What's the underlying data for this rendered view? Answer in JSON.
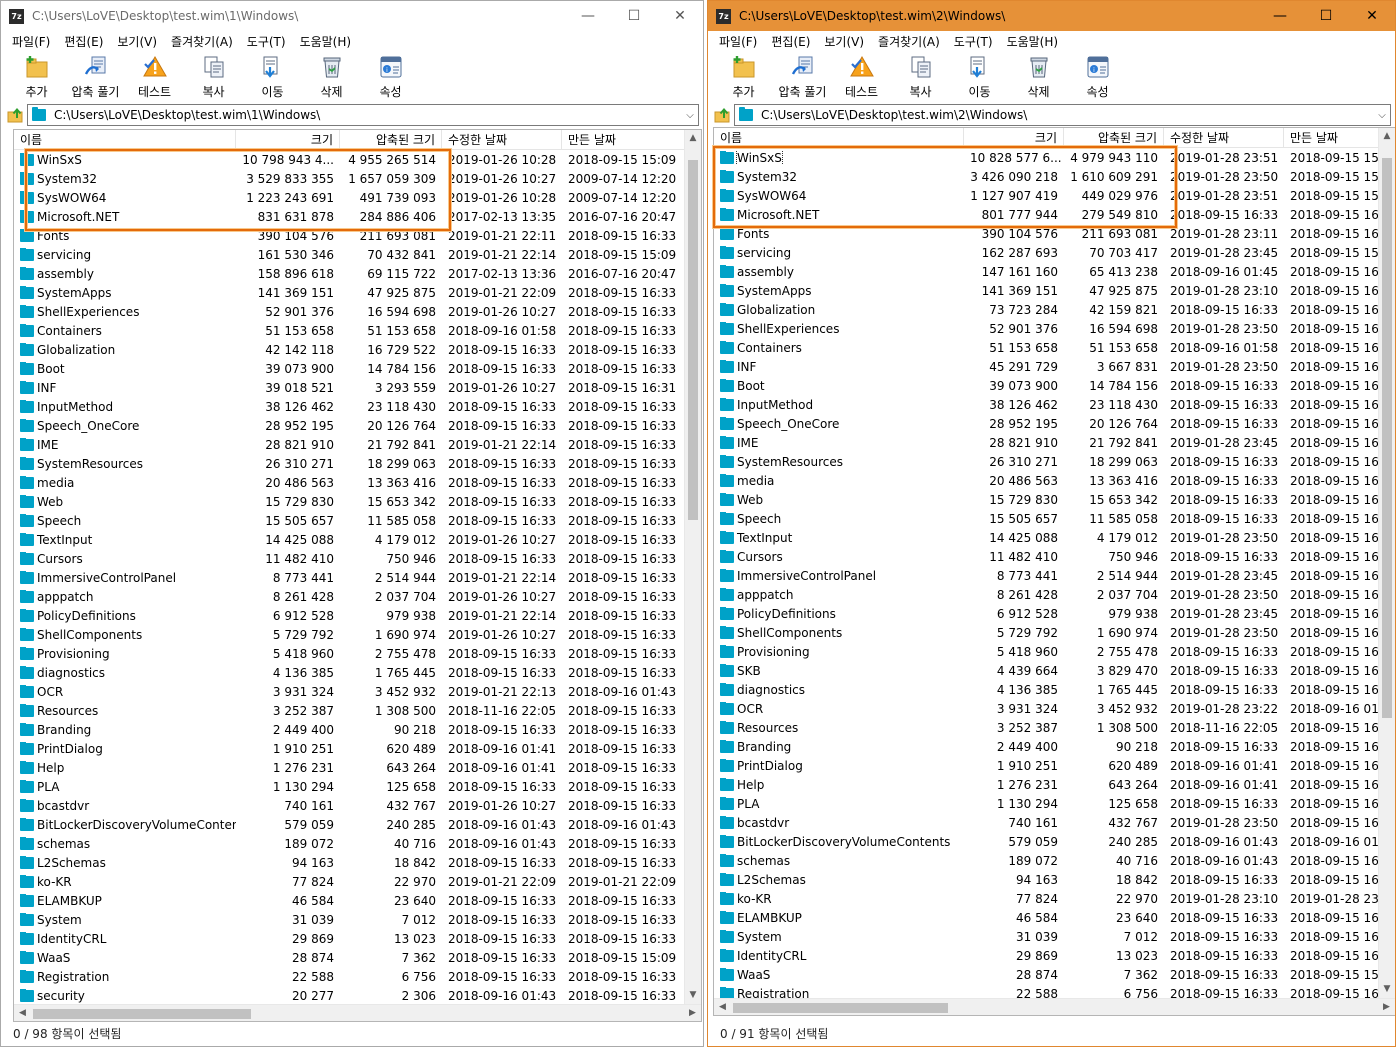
{
  "windows": [
    {
      "title": "C:\\Users\\LoVE\\Desktop\\test.wim\\1\\Windows\\",
      "path": "C:\\Users\\LoVE\\Desktop\\test.wim\\1\\Windows\\",
      "status": "0 / 98 항목이 선택됨",
      "accent": "#ffffff",
      "rows": [
        [
          "WinSxS",
          "10 798 943 4...",
          "4 955 265 514",
          "2019-01-26 10:28",
          "2018-09-15 15:09"
        ],
        [
          "System32",
          "3 529 833 355",
          "1 657 059 309",
          "2019-01-26 10:27",
          "2009-07-14 12:20"
        ],
        [
          "SysWOW64",
          "1 223 243 691",
          "491 739 093",
          "2019-01-26 10:28",
          "2009-07-14 12:20"
        ],
        [
          "Microsoft.NET",
          "831 631 878",
          "284 886 406",
          "2017-02-13 13:35",
          "2016-07-16 20:47"
        ],
        [
          "Fonts",
          "390 104 576",
          "211 693 081",
          "2019-01-21 22:11",
          "2018-09-15 16:33"
        ],
        [
          "servicing",
          "161 530 346",
          "70 432 841",
          "2019-01-21 22:14",
          "2018-09-15 15:09"
        ],
        [
          "assembly",
          "158 896 618",
          "69 115 722",
          "2017-02-13 13:36",
          "2016-07-16 20:47"
        ],
        [
          "SystemApps",
          "141 369 151",
          "47 925 875",
          "2019-01-21 22:09",
          "2018-09-15 16:33"
        ],
        [
          "ShellExperiences",
          "52 901 376",
          "16 594 698",
          "2019-01-26 10:27",
          "2018-09-15 16:33"
        ],
        [
          "Containers",
          "51 153 658",
          "51 153 658",
          "2018-09-16 01:58",
          "2018-09-15 16:33"
        ],
        [
          "Globalization",
          "42 142 118",
          "16 729 522",
          "2018-09-15 16:33",
          "2018-09-15 16:33"
        ],
        [
          "Boot",
          "39 073 900",
          "14 784 156",
          "2018-09-15 16:33",
          "2018-09-15 16:33"
        ],
        [
          "INF",
          "39 018 521",
          "3 293 559",
          "2019-01-26 10:27",
          "2018-09-15 16:31"
        ],
        [
          "InputMethod",
          "38 126 462",
          "23 118 430",
          "2018-09-15 16:33",
          "2018-09-15 16:33"
        ],
        [
          "Speech_OneCore",
          "28 952 195",
          "20 126 764",
          "2018-09-15 16:33",
          "2018-09-15 16:33"
        ],
        [
          "IME",
          "28 821 910",
          "21 792 841",
          "2019-01-21 22:14",
          "2018-09-15 16:33"
        ],
        [
          "SystemResources",
          "26 310 271",
          "18 299 063",
          "2018-09-15 16:33",
          "2018-09-15 16:33"
        ],
        [
          "media",
          "20 486 563",
          "13 363 416",
          "2018-09-15 16:33",
          "2018-09-15 16:33"
        ],
        [
          "Web",
          "15 729 830",
          "15 653 342",
          "2018-09-15 16:33",
          "2018-09-15 16:33"
        ],
        [
          "Speech",
          "15 505 657",
          "11 585 058",
          "2018-09-15 16:33",
          "2018-09-15 16:33"
        ],
        [
          "TextInput",
          "14 425 088",
          "4 179 012",
          "2019-01-26 10:27",
          "2018-09-15 16:33"
        ],
        [
          "Cursors",
          "11 482 410",
          "750 946",
          "2018-09-15 16:33",
          "2018-09-15 16:33"
        ],
        [
          "ImmersiveControlPanel",
          "8 773 441",
          "2 514 944",
          "2019-01-21 22:14",
          "2018-09-15 16:33"
        ],
        [
          "apppatch",
          "8 261 428",
          "2 037 704",
          "2019-01-26 10:27",
          "2018-09-15 16:33"
        ],
        [
          "PolicyDefinitions",
          "6 912 528",
          "979 938",
          "2019-01-21 22:14",
          "2018-09-15 16:33"
        ],
        [
          "ShellComponents",
          "5 729 792",
          "1 690 974",
          "2019-01-26 10:27",
          "2018-09-15 16:33"
        ],
        [
          "Provisioning",
          "5 418 960",
          "2 755 478",
          "2018-09-15 16:33",
          "2018-09-15 16:33"
        ],
        [
          "diagnostics",
          "4 136 385",
          "1 765 445",
          "2018-09-15 16:33",
          "2018-09-15 16:33"
        ],
        [
          "OCR",
          "3 931 324",
          "3 452 932",
          "2019-01-21 22:13",
          "2018-09-16 01:43"
        ],
        [
          "Resources",
          "3 252 387",
          "1 308 500",
          "2018-11-16 22:05",
          "2018-09-15 16:33"
        ],
        [
          "Branding",
          "2 449 400",
          "90 218",
          "2018-09-15 16:33",
          "2018-09-15 16:33"
        ],
        [
          "PrintDialog",
          "1 910 251",
          "620 489",
          "2018-09-16 01:41",
          "2018-09-15 16:33"
        ],
        [
          "Help",
          "1 276 231",
          "643 264",
          "2018-09-16 01:41",
          "2018-09-15 16:33"
        ],
        [
          "PLA",
          "1 130 294",
          "125 658",
          "2018-09-15 16:33",
          "2018-09-15 16:33"
        ],
        [
          "bcastdvr",
          "740 161",
          "432 767",
          "2019-01-26 10:27",
          "2018-09-15 16:33"
        ],
        [
          "BitLockerDiscoveryVolumeContents",
          "579 059",
          "240 285",
          "2018-09-16 01:43",
          "2018-09-16 01:43"
        ],
        [
          "schemas",
          "189 072",
          "40 716",
          "2018-09-16 01:43",
          "2018-09-15 16:33"
        ],
        [
          "L2Schemas",
          "94 163",
          "18 842",
          "2018-09-15 16:33",
          "2018-09-15 16:33"
        ],
        [
          "ko-KR",
          "77 824",
          "22 970",
          "2019-01-21 22:09",
          "2019-01-21 22:09"
        ],
        [
          "ELAMBKUP",
          "46 584",
          "23 640",
          "2018-09-15 16:33",
          "2018-09-15 16:33"
        ],
        [
          "System",
          "31 039",
          "7 012",
          "2018-09-15 16:33",
          "2018-09-15 16:33"
        ],
        [
          "IdentityCRL",
          "29 869",
          "13 023",
          "2018-09-15 16:33",
          "2018-09-15 16:33"
        ],
        [
          "WaaS",
          "28 874",
          "7 362",
          "2018-09-15 16:33",
          "2018-09-15 15:09"
        ],
        [
          "Registration",
          "22 588",
          "6 756",
          "2018-09-15 16:33",
          "2018-09-15 16:33"
        ],
        [
          "security",
          "20 277",
          "2 306",
          "2018-09-16 01:43",
          "2018-09-15 16:33"
        ]
      ]
    },
    {
      "title": "C:\\Users\\LoVE\\Desktop\\test.wim\\2\\Windows\\",
      "path": "C:\\Users\\LoVE\\Desktop\\test.wim\\2\\Windows\\",
      "status": "0 / 91 항목이 선택됨",
      "accent": "#e69138",
      "rows": [
        [
          "WinSxS",
          "10 828 577 6...",
          "4 979 943 110",
          "2019-01-28 23:51",
          "2018-09-15 15"
        ],
        [
          "System32",
          "3 426 090 218",
          "1 610 609 291",
          "2019-01-28 23:50",
          "2018-09-15 15"
        ],
        [
          "SysWOW64",
          "1 127 907 419",
          "449 029 976",
          "2019-01-28 23:51",
          "2018-09-15 15"
        ],
        [
          "Microsoft.NET",
          "801 777 944",
          "279 549 810",
          "2018-09-15 16:33",
          "2018-09-15 16"
        ],
        [
          "Fonts",
          "390 104 576",
          "211 693 081",
          "2019-01-28 23:11",
          "2018-09-15 16"
        ],
        [
          "servicing",
          "162 287 693",
          "70 703 417",
          "2019-01-28 23:45",
          "2018-09-15 15"
        ],
        [
          "assembly",
          "147 161 160",
          "65 413 238",
          "2018-09-16 01:45",
          "2018-09-15 16"
        ],
        [
          "SystemApps",
          "141 369 151",
          "47 925 875",
          "2019-01-28 23:10",
          "2018-09-15 16"
        ],
        [
          "Globalization",
          "73 723 284",
          "42 159 821",
          "2018-09-15 16:33",
          "2018-09-15 16"
        ],
        [
          "ShellExperiences",
          "52 901 376",
          "16 594 698",
          "2019-01-28 23:50",
          "2018-09-15 16"
        ],
        [
          "Containers",
          "51 153 658",
          "51 153 658",
          "2018-09-16 01:58",
          "2018-09-15 16"
        ],
        [
          "INF",
          "45 291 729",
          "3 667 831",
          "2019-01-28 23:50",
          "2018-09-15 16"
        ],
        [
          "Boot",
          "39 073 900",
          "14 784 156",
          "2018-09-15 16:33",
          "2018-09-15 16"
        ],
        [
          "InputMethod",
          "38 126 462",
          "23 118 430",
          "2018-09-15 16:33",
          "2018-09-15 16"
        ],
        [
          "Speech_OneCore",
          "28 952 195",
          "20 126 764",
          "2018-09-15 16:33",
          "2018-09-15 16"
        ],
        [
          "IME",
          "28 821 910",
          "21 792 841",
          "2019-01-28 23:45",
          "2018-09-15 16"
        ],
        [
          "SystemResources",
          "26 310 271",
          "18 299 063",
          "2018-09-15 16:33",
          "2018-09-15 16"
        ],
        [
          "media",
          "20 486 563",
          "13 363 416",
          "2018-09-15 16:33",
          "2018-09-15 16"
        ],
        [
          "Web",
          "15 729 830",
          "15 653 342",
          "2018-09-15 16:33",
          "2018-09-15 16"
        ],
        [
          "Speech",
          "15 505 657",
          "11 585 058",
          "2018-09-15 16:33",
          "2018-09-15 16"
        ],
        [
          "TextInput",
          "14 425 088",
          "4 179 012",
          "2019-01-28 23:50",
          "2018-09-15 16"
        ],
        [
          "Cursors",
          "11 482 410",
          "750 946",
          "2018-09-15 16:33",
          "2018-09-15 16"
        ],
        [
          "ImmersiveControlPanel",
          "8 773 441",
          "2 514 944",
          "2019-01-28 23:45",
          "2018-09-15 16"
        ],
        [
          "apppatch",
          "8 261 428",
          "2 037 704",
          "2019-01-28 23:50",
          "2018-09-15 16"
        ],
        [
          "PolicyDefinitions",
          "6 912 528",
          "979 938",
          "2019-01-28 23:45",
          "2018-09-15 16"
        ],
        [
          "ShellComponents",
          "5 729 792",
          "1 690 974",
          "2019-01-28 23:50",
          "2018-09-15 16"
        ],
        [
          "Provisioning",
          "5 418 960",
          "2 755 478",
          "2018-09-15 16:33",
          "2018-09-15 16"
        ],
        [
          "SKB",
          "4 439 664",
          "3 829 470",
          "2018-09-15 16:33",
          "2018-09-15 16"
        ],
        [
          "diagnostics",
          "4 136 385",
          "1 765 445",
          "2018-09-15 16:33",
          "2018-09-15 16"
        ],
        [
          "OCR",
          "3 931 324",
          "3 452 932",
          "2019-01-28 23:22",
          "2018-09-16 01"
        ],
        [
          "Resources",
          "3 252 387",
          "1 308 500",
          "2018-11-16 22:05",
          "2018-09-15 16"
        ],
        [
          "Branding",
          "2 449 400",
          "90 218",
          "2018-09-15 16:33",
          "2018-09-15 16"
        ],
        [
          "PrintDialog",
          "1 910 251",
          "620 489",
          "2018-09-16 01:41",
          "2018-09-15 16"
        ],
        [
          "Help",
          "1 276 231",
          "643 264",
          "2018-09-16 01:41",
          "2018-09-15 16"
        ],
        [
          "PLA",
          "1 130 294",
          "125 658",
          "2018-09-15 16:33",
          "2018-09-15 16"
        ],
        [
          "bcastdvr",
          "740 161",
          "432 767",
          "2019-01-28 23:50",
          "2018-09-15 16"
        ],
        [
          "BitLockerDiscoveryVolumeContents",
          "579 059",
          "240 285",
          "2018-09-16 01:43",
          "2018-09-16 01"
        ],
        [
          "schemas",
          "189 072",
          "40 716",
          "2018-09-16 01:43",
          "2018-09-15 16"
        ],
        [
          "L2Schemas",
          "94 163",
          "18 842",
          "2018-09-15 16:33",
          "2018-09-15 16"
        ],
        [
          "ko-KR",
          "77 824",
          "22 970",
          "2019-01-28 23:10",
          "2019-01-28 23"
        ],
        [
          "ELAMBKUP",
          "46 584",
          "23 640",
          "2018-09-15 16:33",
          "2018-09-15 16"
        ],
        [
          "System",
          "31 039",
          "7 012",
          "2018-09-15 16:33",
          "2018-09-15 16"
        ],
        [
          "IdentityCRL",
          "29 869",
          "13 023",
          "2018-09-15 16:33",
          "2018-09-15 16"
        ],
        [
          "WaaS",
          "28 874",
          "7 362",
          "2018-09-15 16:33",
          "2018-09-15 15"
        ],
        [
          "Registration",
          "22 588",
          "6 756",
          "2018-09-15 16:33",
          "2018-09-15 16"
        ]
      ]
    }
  ],
  "app_icon_label": "7z",
  "menu": [
    "파일(F)",
    "편집(E)",
    "보기(V)",
    "즐겨찾기(A)",
    "도구(T)",
    "도움말(H)"
  ],
  "toolbar": [
    "추가",
    "압축 풀기",
    "테스트",
    "복사",
    "이동",
    "삭제",
    "속성"
  ],
  "columns": [
    "이름",
    "크기",
    "압축된 크기",
    "수정한 날짜",
    "만든 날짜"
  ],
  "window_controls": {
    "minimize": "—",
    "maximize": "☐",
    "close": "✕"
  },
  "colors": {
    "folder": "#00a2c8",
    "highlight": "#e46b0a",
    "active_title": "#e69138"
  }
}
